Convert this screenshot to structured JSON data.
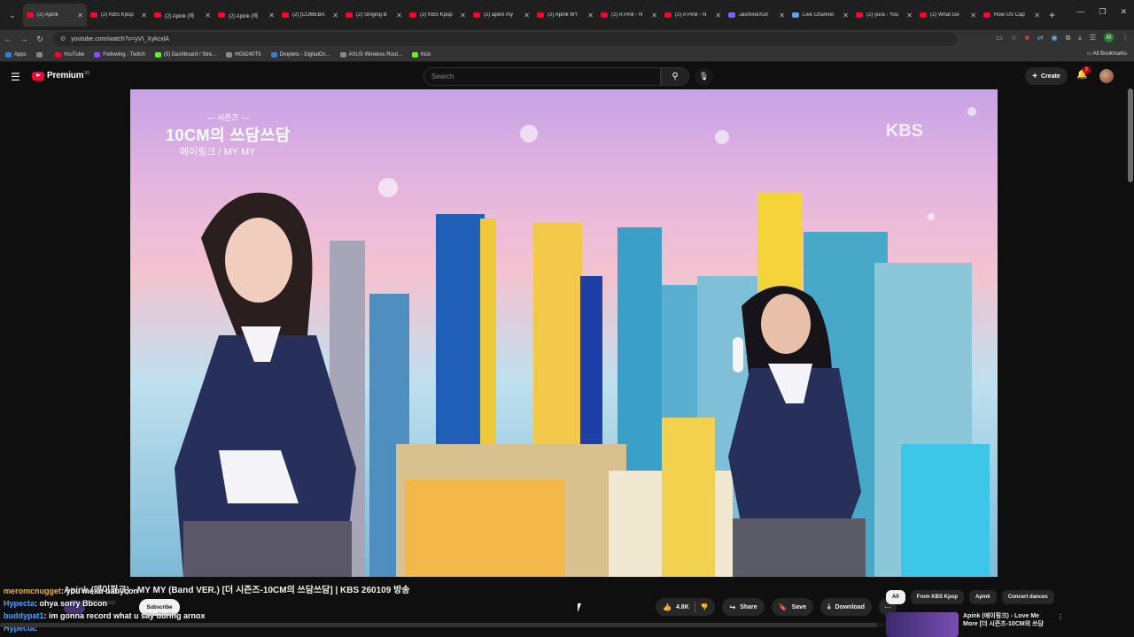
{
  "tabs": [
    {
      "label": "(2) Apink",
      "active": true
    },
    {
      "label": "(2) KBS Kpop"
    },
    {
      "label": "(2) Apink (에"
    },
    {
      "label": "(2) Apink (에"
    },
    {
      "label": "(2) [COMEBA"
    },
    {
      "label": "(2) Singing B"
    },
    {
      "label": "(2) KBS Kpop"
    },
    {
      "label": "(2) apink my"
    },
    {
      "label": "(2) Apink MY"
    },
    {
      "label": "(2) A Pink - N"
    },
    {
      "label": "(2) A Pink - N"
    },
    {
      "label": "JasmineXu0"
    },
    {
      "label": "Live Channel"
    },
    {
      "label": "(2) yura - You"
    },
    {
      "label": "(2) What Ge"
    },
    {
      "label": "How US Cap"
    }
  ],
  "address": {
    "url": "youtube.com/watch?v=yVI_XykcxlA"
  },
  "bookmarks": {
    "items": [
      {
        "label": "Apps"
      },
      {
        "label": "YouTube"
      },
      {
        "label": "Following - Twitch"
      },
      {
        "label": "(5) Dashboard / Stre..."
      },
      {
        "label": "HG8240T5"
      },
      {
        "label": "Droplets - DigitalOc..."
      },
      {
        "label": "ASUS Wireless Rout..."
      },
      {
        "label": "Kick"
      }
    ],
    "all_bookmarks": "All Bookmarks"
  },
  "header": {
    "logo_text": "Premium",
    "logo_sup": "99",
    "search_placeholder": "Search",
    "create_label": "Create",
    "notification_count": "2"
  },
  "video": {
    "show_small": "— 시즌즈 —",
    "show_big": "10CM의 쓰담쓰담",
    "song": "에이핑크 / MY MY",
    "network": "KBS"
  },
  "title": "Apink (에이핑크) - MY MY (Band VER.) [더 시즌즈-10CM의 쓰담쓰담] | KBS 260109 방송",
  "channel": {
    "name": "KBS Kpop",
    "subscribe_label": "Subscribe"
  },
  "chat": [
    {
      "user": "meromcnugget",
      "message": "you mean babycon",
      "user_color": "#e8b84a"
    },
    {
      "user": "Hypecta",
      "message": "ohya sorry Bbcon",
      "user_color": "#4fa3ff"
    },
    {
      "user": "buddypat1",
      "message": "im gonna record what u say during arnox",
      "user_color": "#4fa3ff"
    },
    {
      "user": "Hypecta",
      "message": "",
      "user_color": "#4fa3ff"
    }
  ],
  "actions": {
    "likes": "4.8K",
    "share": "Share",
    "save": "Save",
    "download": "Download"
  },
  "chips": [
    "All",
    "From KBS Kpop",
    "Apink",
    "Concert dances"
  ],
  "recommendation": {
    "title": "Apink (에이핑크) - Love Me More [더 시즌즈-10CM의 쓰담"
  }
}
